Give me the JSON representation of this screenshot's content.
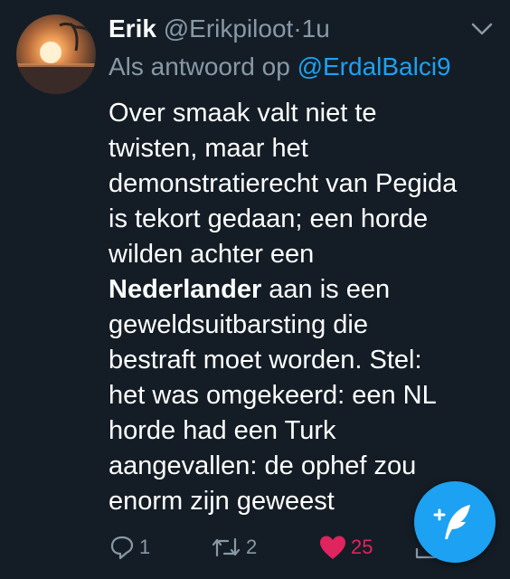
{
  "tweet": {
    "author_name": "Erik",
    "author_handle": "@Erikpiloot",
    "separator": "·",
    "time": "1u",
    "reply_prefix": "Als antwoord op",
    "reply_to": "@ErdalBalci9",
    "body": {
      "line1": "Over smaak valt niet te",
      "line2": "twisten, maar het",
      "line3": "demonstratierecht van Pegida",
      "line4": "is tekort gedaan; een horde",
      "line5": "wilden achter een",
      "line6_bold": "Nederlander",
      "line6_rest": " aan is een",
      "line7": "geweldsuitbarsting die",
      "line8": "bestraft moet worden. Stel:",
      "line9": "het was omgekeerd: een NL",
      "line10": "horde had een Turk",
      "line11": "aangevallen: de ophef zou",
      "line12": "enorm zijn geweest"
    },
    "actions": {
      "reply_count": "1",
      "retweet_count": "2",
      "like_count": "25",
      "like_color": "#e0245e"
    }
  },
  "icons": {
    "menu": "chevron-down-icon",
    "reply": "reply-icon",
    "retweet": "retweet-icon",
    "like": "heart-icon",
    "compose": "compose-tweet-icon"
  },
  "colors": {
    "background": "#141d26",
    "accent": "#1da1f2",
    "muted": "#8899a6"
  }
}
